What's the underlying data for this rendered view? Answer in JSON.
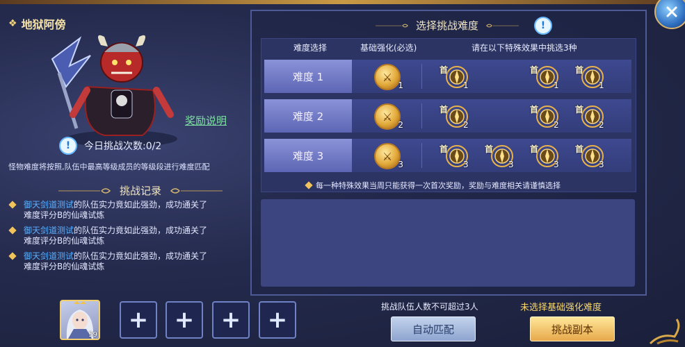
{
  "boss": {
    "name": "地狱阿傍",
    "reward_link": "奖励说明",
    "today_label": "今日挑战次数:0/2",
    "match_note": "怪物难度将按照,队伍中最高等级成员的等级段进行难度匹配"
  },
  "records": {
    "title": "挑战记录",
    "items": [
      {
        "name": "御天剑道测试",
        "text1": "的队伍实力竟如此强劲，成功通关了",
        "text2": "难度评分B的仙魂试炼"
      },
      {
        "name": "御天剑道测试",
        "text1": "的队伍实力竟如此强劲，成功通关了",
        "text2": "难度评分B的仙魂试炼"
      },
      {
        "name": "御天剑道测试",
        "text1": "的队伍实力竟如此强劲，成功通关了",
        "text2": "难度评分B的仙魂试炼"
      }
    ]
  },
  "team": {
    "member_level": "59",
    "empty_slot_symbol": "+"
  },
  "difficulty": {
    "title": "选择挑战难度",
    "info_symbol": "!",
    "col_diff": "难度选择",
    "col_base": "基础强化(必选)",
    "col_special": "请在以下特殊效果中挑选3种",
    "first_mark": "首",
    "rows": [
      {
        "label": "难度 1",
        "base": "1",
        "effects": [
          "1",
          null,
          "1",
          "1"
        ]
      },
      {
        "label": "难度 2",
        "base": "2",
        "effects": [
          "2",
          null,
          "2",
          "2"
        ]
      },
      {
        "label": "难度 3",
        "base": "3",
        "effects": [
          "3",
          "3",
          "3",
          "3"
        ]
      }
    ],
    "notice": "每一种特殊效果当周只能获得一次首次奖励，奖励与难度相关请谨慎选择"
  },
  "footer": {
    "team_limit": "挑战队伍人数不可超过3人",
    "no_base": "未选择基础强化难度",
    "auto_match": "自动匹配",
    "challenge": "挑战副本"
  },
  "colors": {
    "gold": "#f4e2a8",
    "link_green": "#7fe0a4",
    "name_blue": "#5ab0ff",
    "warn_yellow": "#f8d86c"
  }
}
